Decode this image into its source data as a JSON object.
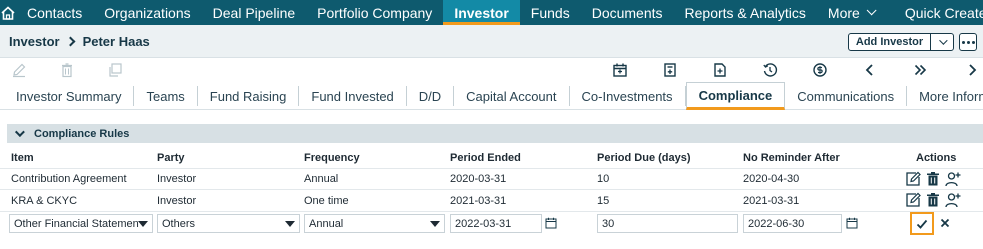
{
  "nav": {
    "items": [
      "Contacts",
      "Organizations",
      "Deal Pipeline",
      "Portfolio Company",
      "Investor",
      "Funds",
      "Documents",
      "Reports & Analytics",
      "More",
      "Quick Create"
    ],
    "active": "Investor",
    "colors": {
      "bar": "#0e5a6e",
      "active": "#138aa6",
      "accent": "#f29a1c"
    }
  },
  "breadcrumb": {
    "parent": "Investor",
    "current": "Peter Haas"
  },
  "header": {
    "add_label": "Add Investor"
  },
  "tabs": [
    "Investor Summary",
    "Teams",
    "Fund Raising",
    "Fund Invested",
    "D/D",
    "Capital Account",
    "Co-Investments",
    "Compliance",
    "Communications",
    "More Information"
  ],
  "active_tab": "Compliance",
  "section": {
    "title": "Compliance Rules"
  },
  "table": {
    "headers": {
      "item": "Item",
      "party": "Party",
      "frequency": "Frequency",
      "period_ended": "Period Ended",
      "period_due": "Period Due (days)",
      "no_reminder": "No Reminder After",
      "actions": "Actions"
    },
    "rows": [
      {
        "item": "Contribution Agreement",
        "party": "Investor",
        "frequency": "Annual",
        "period_ended": "2020-03-31",
        "period_due": "10",
        "no_reminder": "2020-04-30"
      },
      {
        "item": "KRA & CKYC",
        "party": "Investor",
        "frequency": "One time",
        "period_ended": "2021-03-31",
        "period_due": "15",
        "no_reminder": "2021-03-31"
      }
    ],
    "edit_row": {
      "item": "Other Financial Statemen",
      "party": "Others",
      "frequency": "Annual",
      "period_ended": "2022-03-31",
      "period_due": "30",
      "no_reminder": "2022-06-30"
    }
  }
}
